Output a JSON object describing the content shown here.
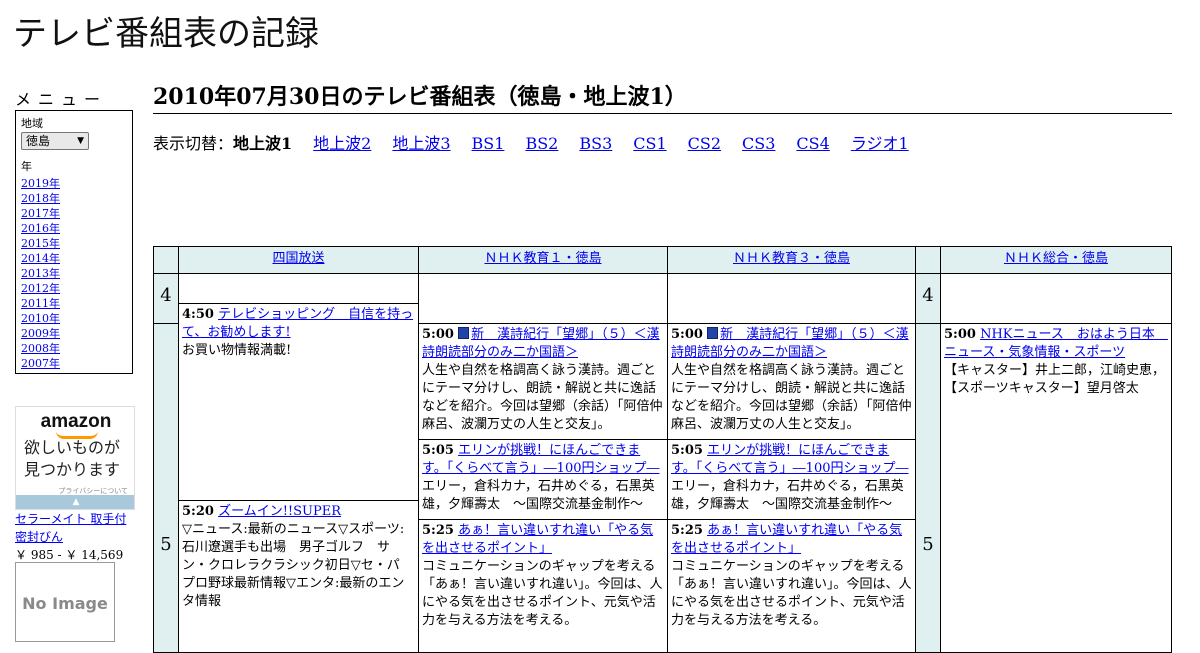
{
  "site": {
    "title": "テレビ番組表の記録"
  },
  "menu": {
    "heading": "メニュー",
    "region_label": "地域",
    "region_value": "徳島",
    "year_label": "年",
    "years": [
      "2019年",
      "2018年",
      "2017年",
      "2016年",
      "2015年",
      "2014年",
      "2013年",
      "2012年",
      "2011年",
      "2010年",
      "2009年",
      "2008年",
      "2007年"
    ]
  },
  "ad": {
    "logo": "amazon",
    "copy": "欲しいものが見つかります",
    "privacy": "プライバシーについて",
    "product_name": "セラーメイト 取手付 密封びん",
    "product_price": "￥ 985 - ￥ 14,569",
    "no_image": "No Image"
  },
  "page": {
    "heading": "2010年07月30日のテレビ番組表（徳島・地上波1）",
    "switch_label": "表示切替：",
    "switch_current": "地上波1",
    "switch_links": [
      "地上波2",
      "地上波3",
      "BS1",
      "BS2",
      "BS3",
      "CS1",
      "CS2",
      "CS3",
      "CS4",
      "ラジオ1"
    ]
  },
  "schedule": {
    "channels": [
      "四国放送",
      "ＮＨＫ教育１・徳島",
      "ＮＨＫ教育３・徳島",
      "ＮＨＫ総合・徳島"
    ],
    "hours": [
      "4",
      "5"
    ],
    "programs": {
      "p1": {
        "time": "4:50",
        "title": "テレビショッピング　自信を持って、お勧めします!",
        "desc": "お買い物情報満載!"
      },
      "p2": {
        "time": "5:20",
        "title": "ズームイン!!SUPER",
        "desc": "▽ニュース:最新のニュース▽スポーツ:石川遼選手も出場　男子ゴルフ　サン・クロレラクラシック初日▽セ・パ プロ野球最新情報▽エンタ:最新のエンタ情報"
      },
      "p3": {
        "time": "5:00",
        "title": "新　漢詩紀行「望郷」（５）＜漢詩朗読部分のみ二か国語＞",
        "desc": "人生や自然を格調高く詠う漢詩。週ごとにテーマ分けし、朗読・解説と共に逸話などを紹介。今回は望郷（余話）「阿倍仲麻呂、波瀾万丈の人生と交友」。"
      },
      "p4": {
        "time": "5:05",
        "title": "エリンが挑戦！にほんごできます。「くらべて言う」―100円ショップ―",
        "desc": "エリー，倉科カナ，石井めぐる，石黒英雄，夕輝壽太　～国際交流基金制作～"
      },
      "p5": {
        "time": "5:25",
        "title": "あぁ！言い違いすれ違い「やる気を出させるポイント」",
        "desc": "コミュニケーションのギャップを考える「あぁ！言い違いすれ違い」。今回は、人にやる気を出させるポイント、元気や活力を与える方法を考える。"
      },
      "p6": {
        "time": "5:00",
        "title": "新　漢詩紀行「望郷」（５）＜漢詩朗読部分のみ二か国語＞",
        "desc": "人生や自然を格調高く詠う漢詩。週ごとにテーマ分けし、朗読・解説と共に逸話などを紹介。今回は望郷（余話）「阿倍仲麻呂、波瀾万丈の人生と交友」。"
      },
      "p7": {
        "time": "5:05",
        "title": "エリンが挑戦！にほんごできます。「くらべて言う」―100円ショップ―",
        "desc": "エリー，倉科カナ，石井めぐる，石黒英雄，夕輝壽太　～国際交流基金制作～"
      },
      "p8": {
        "time": "5:25",
        "title": "あぁ！言い違いすれ違い「やる気を出させるポイント」",
        "desc": "コミュニケーションのギャップを考える「あぁ！言い違いすれ違い」。今回は、人にやる気を出させるポイント、元気や活力を与える方法を考える。"
      },
      "p9": {
        "time": "5:00",
        "title": "NHKニュース　おはよう日本　ニュース・気象情報・スポーツ",
        "desc": "【キャスター】井上二郎，江崎史恵，【スポーツキャスター】望月啓太"
      }
    }
  }
}
